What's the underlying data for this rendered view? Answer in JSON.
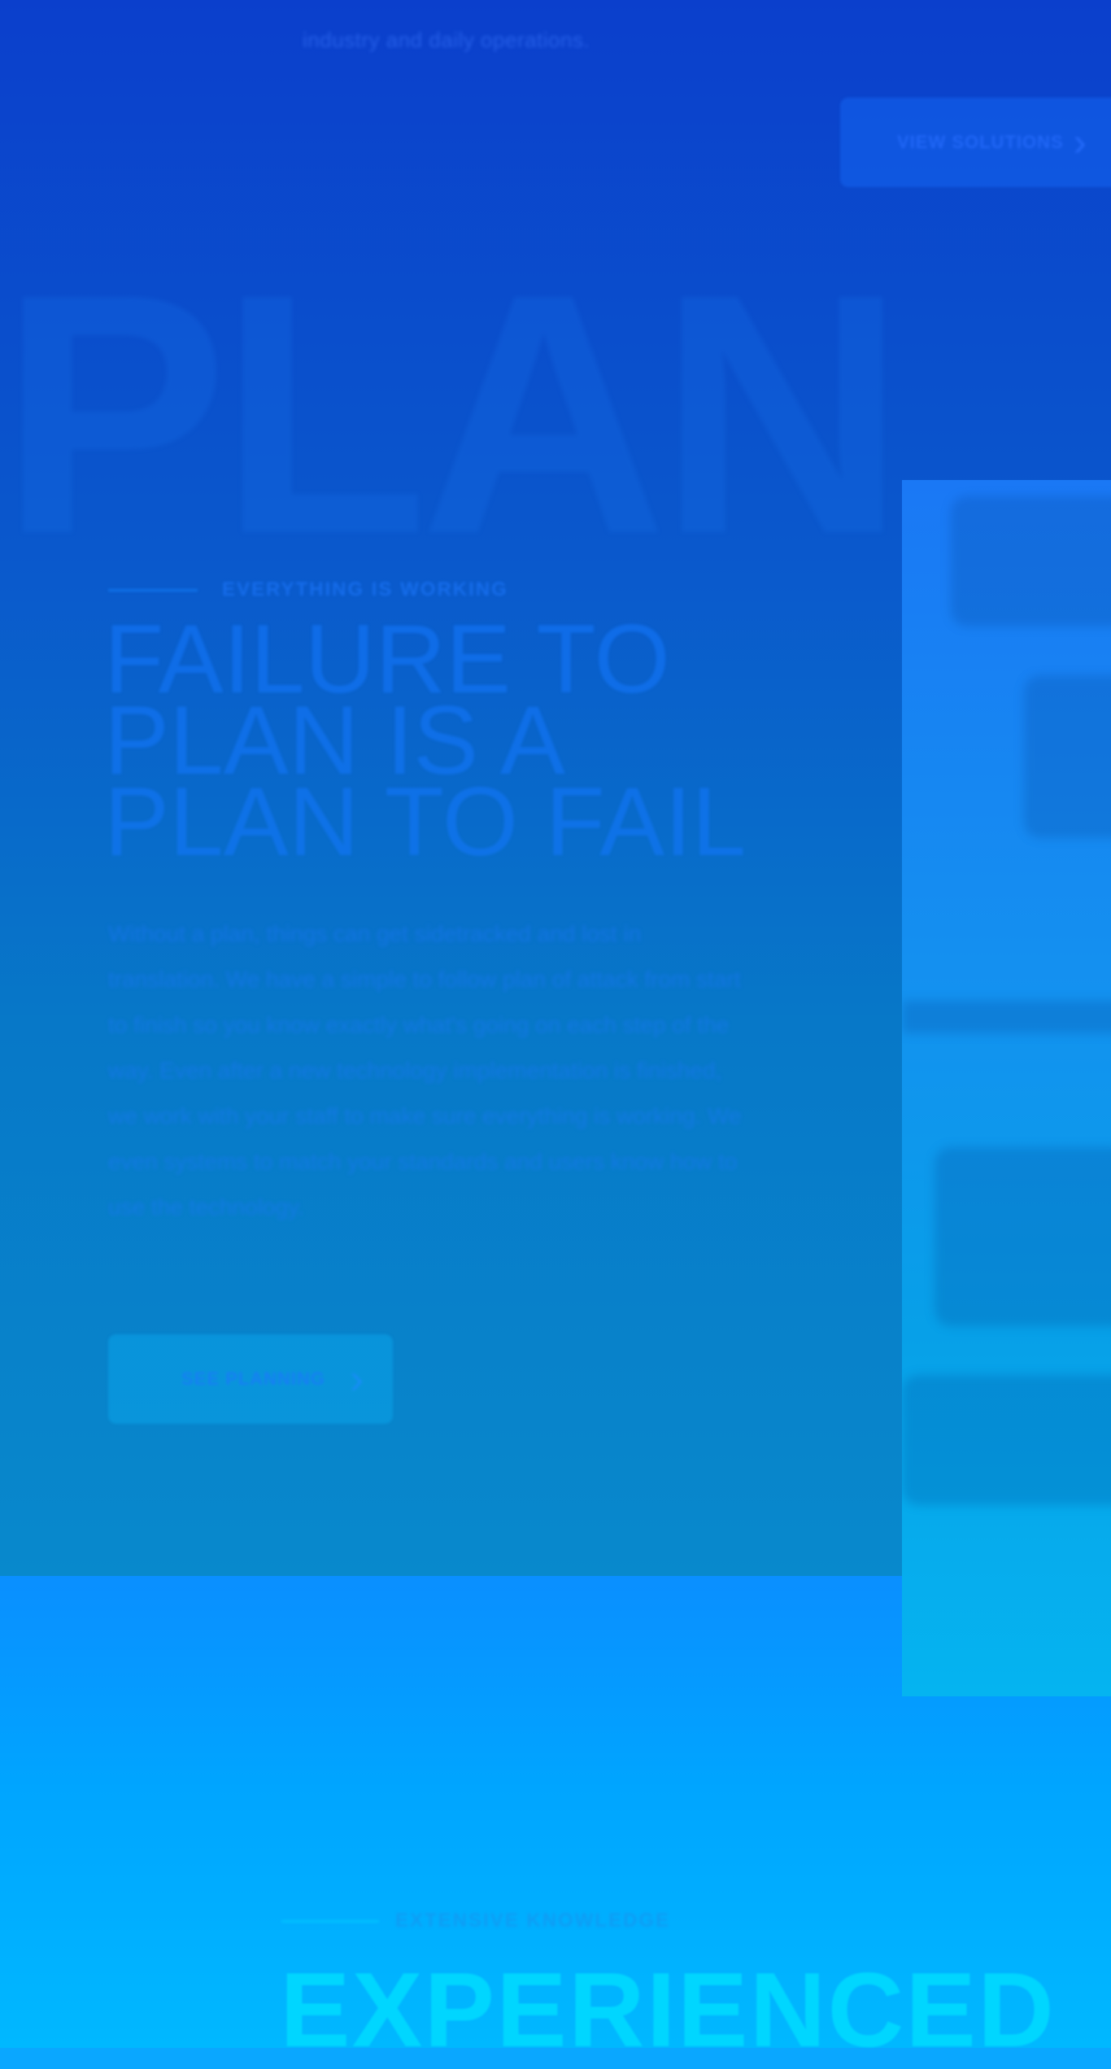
{
  "top_section": {
    "text": "industry and daily operations.",
    "button_label": "VIEW SOLUTIONS",
    "button_icon": "chevron-right-icon"
  },
  "watermark": {
    "text": "PLANNING"
  },
  "plan_section": {
    "eyebrow": "EVERYTHING IS WORKING",
    "headline_lines": [
      "FAILURE TO",
      "PLAN IS A",
      "PLAN TO FAIL"
    ],
    "body": "Without a plan, things can get sidetracked and lost in translation. We have a simple to follow plan of attack from start to finish so you know exactly what's going on each step of the way. Even after a new technology implementation is finished, we work with your staff to make sure everything is working. We even systems to match your standards and users know how to use the technology.",
    "cta_label": "SEE PLANNING",
    "cta_icon": "chevron-right-icon"
  },
  "experience_section": {
    "eyebrow": "EXTENSIVE KNOWLEDGE",
    "headline": "EXPERIENCED"
  },
  "colors": {
    "hero_top": "#0b3fcc",
    "hero_bottom": "#0889cc",
    "lower_bg": "#00a5ff",
    "accent": "#00dcff"
  }
}
